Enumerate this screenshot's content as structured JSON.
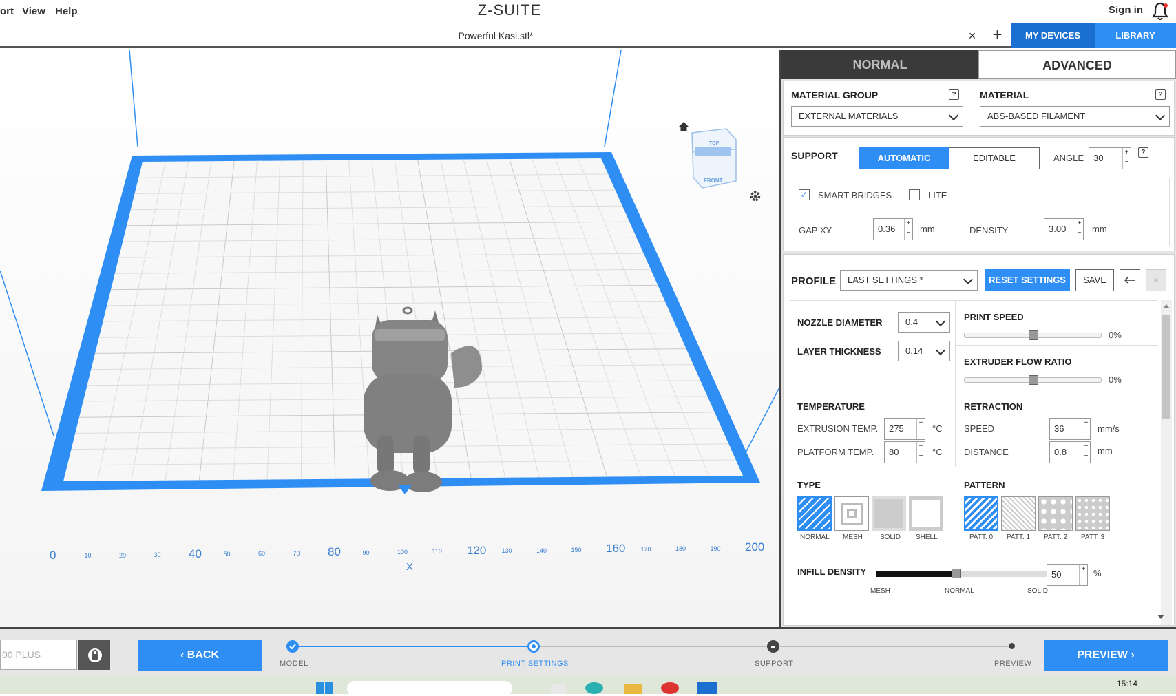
{
  "menubar": {
    "items": [
      "ort",
      "View",
      "Help"
    ],
    "logo": "Z-SUITE",
    "signin": "Sign in"
  },
  "tabs": {
    "file": "Powerful Kasi.stl*",
    "close": "×",
    "add": "+",
    "my_devices": "MY DEVICES",
    "library": "LIBRARY"
  },
  "viewport": {
    "cube_top": "TOP",
    "cube_front": "FRONT",
    "axis_ticks": [
      "0",
      "10",
      "20",
      "30",
      "40",
      "50",
      "60",
      "70",
      "80",
      "90",
      "100",
      "110",
      "120",
      "130",
      "140",
      "150",
      "160",
      "170",
      "180",
      "190",
      "200"
    ],
    "axis_label": "X"
  },
  "panel": {
    "mode_tabs": [
      "NORMAL",
      "ADVANCED"
    ],
    "material_group": {
      "label": "MATERIAL GROUP",
      "value": "EXTERNAL MATERIALS"
    },
    "material": {
      "label": "MATERIAL",
      "value": "ABS-BASED FILAMENT"
    },
    "help": "?",
    "support": {
      "label": "SUPPORT",
      "automatic": "AUTOMATIC",
      "editable": "EDITABLE",
      "angle_label": "ANGLE",
      "angle": "30",
      "smart_bridges": "SMART BRIDGES",
      "smart_bridges_checked": true,
      "lite": "LITE",
      "lite_checked": false,
      "gap_xy_label": "GAP XY",
      "gap_xy": "0.36",
      "gap_unit": "mm",
      "density_label": "DENSITY",
      "density": "3.00",
      "density_unit": "mm"
    },
    "profile": {
      "label": "PROFILE",
      "value": "LAST SETTINGS *",
      "reset": "RESET SETTINGS",
      "save": "SAVE"
    },
    "nozzle": {
      "label": "NOZZLE DIAMETER",
      "value": "0.4"
    },
    "layer": {
      "label": "LAYER THICKNESS",
      "value": "0.14"
    },
    "print_speed": {
      "label": "PRINT SPEED",
      "value": "0%",
      "level": 0.5
    },
    "flow_ratio": {
      "label": "EXTRUDER FLOW RATIO",
      "value": "0%",
      "level": 0.5
    },
    "temperature": {
      "label": "TEMPERATURE",
      "extrusion_label": "EXTRUSION TEMP.",
      "extrusion": "275",
      "platform_label": "PLATFORM TEMP.",
      "platform": "80",
      "unit": "°C"
    },
    "retraction": {
      "label": "RETRACTION",
      "speed_label": "SPEED",
      "speed": "36",
      "speed_unit": "mm/s",
      "distance_label": "DISTANCE",
      "distance": "0.8",
      "distance_unit": "mm"
    },
    "type": {
      "label": "TYPE",
      "options": [
        "NORMAL",
        "MESH",
        "SOLID",
        "SHELL"
      ]
    },
    "pattern": {
      "label": "PATTERN",
      "options": [
        "PATT. 0",
        "PATT. 1",
        "PATT. 2",
        "PATT. 3"
      ]
    },
    "infill": {
      "label": "INFILL DENSITY",
      "value": "50",
      "unit": "%",
      "level": 0.5,
      "marks": [
        "MESH",
        "NORMAL",
        "SOLID"
      ]
    }
  },
  "bottom": {
    "printer": "00 PLUS",
    "back": "BACK",
    "preview": "PREVIEW",
    "steps": [
      "MODEL",
      "PRINT SETTINGS",
      "SUPPORT",
      "PREVIEW"
    ]
  },
  "taskbar": {
    "time": "15:14"
  },
  "colors": {
    "accent": "#2f8ef4",
    "dark_accent": "#1a6fd1",
    "bed_border": "#2f8ef4"
  }
}
